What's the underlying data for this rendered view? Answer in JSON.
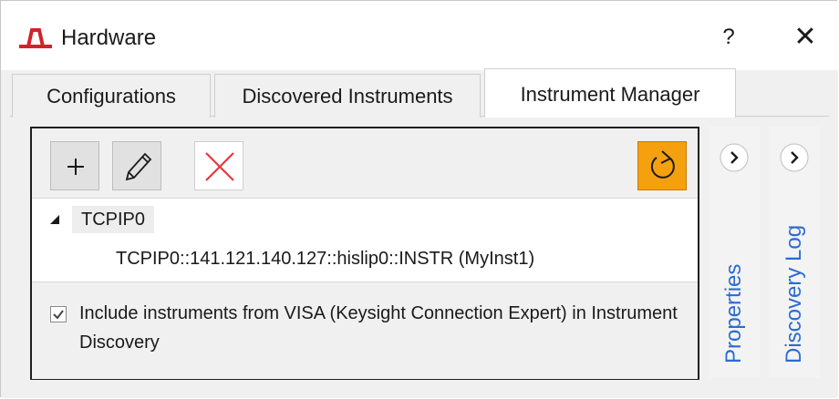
{
  "window": {
    "title": "Hardware",
    "help_label": "?",
    "close_label": "✕"
  },
  "tabs": [
    {
      "label": "Configurations",
      "active": false
    },
    {
      "label": "Discovered Instruments",
      "active": false
    },
    {
      "label": "Instrument Manager",
      "active": true
    }
  ],
  "toolbar": {
    "add_icon": "plus-icon",
    "edit_icon": "pencil-icon",
    "delete_icon": "red-x-icon",
    "refresh_icon": "refresh-icon"
  },
  "tree": {
    "root": {
      "label": "TCPIP0",
      "expanded": true
    },
    "children": [
      {
        "label": "TCPIP0::141.121.140.127::hislip0::INSTR  (MyInst1)"
      }
    ]
  },
  "option": {
    "checked": true,
    "label": "Include instruments from VISA (Keysight Connection Expert) in Instrument Discovery"
  },
  "side_panels": [
    {
      "label": "Properties"
    },
    {
      "label": "Discovery Log"
    }
  ],
  "colors": {
    "refresh_bg": "#f5a00f",
    "side_label": "#2a6bd1",
    "delete_icon": "#e8373c"
  }
}
